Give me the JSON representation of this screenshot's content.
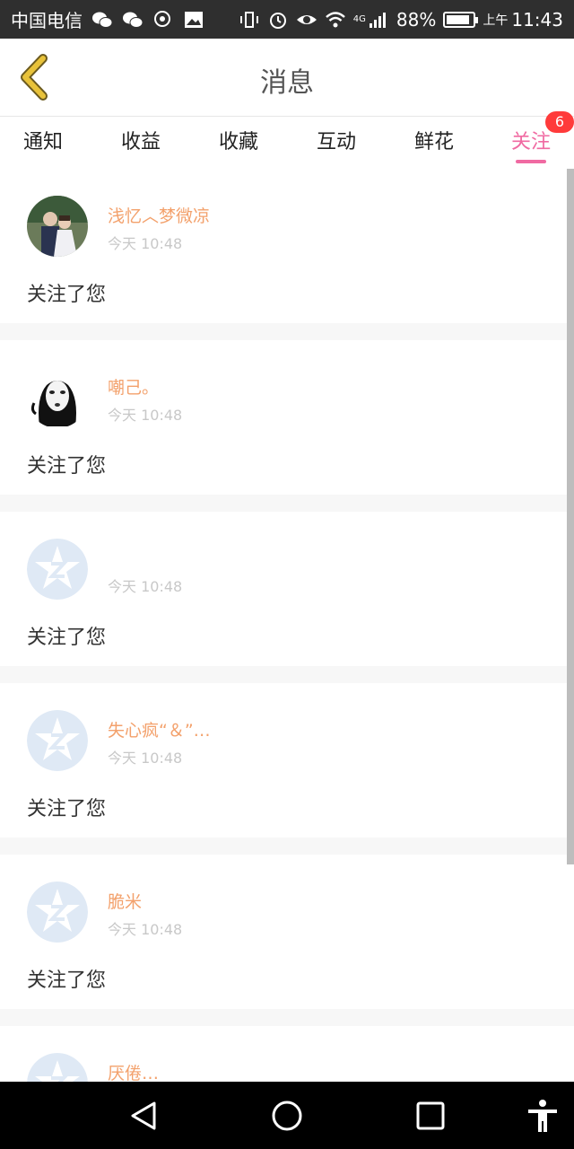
{
  "status_bar": {
    "carrier": "中国电信",
    "network": "4G",
    "battery": "88%",
    "battery_level": 0.88,
    "ampm": "上午",
    "time": "11:43"
  },
  "header": {
    "title": "消息",
    "back_icon": "chevron-left-icon"
  },
  "tabs": [
    {
      "label": "通知",
      "active": false
    },
    {
      "label": "收益",
      "active": false
    },
    {
      "label": "收藏",
      "active": false
    },
    {
      "label": "互动",
      "active": false
    },
    {
      "label": "鲜花",
      "active": false
    },
    {
      "label": "关注",
      "active": true,
      "badge": "6"
    }
  ],
  "items": [
    {
      "name": "浅忆︿梦微凉",
      "time": "今天 10:48",
      "action": "关注了您",
      "avatar": "photo-couple"
    },
    {
      "name": "嘲己。",
      "time": "今天 10:48",
      "action": "关注了您",
      "avatar": "photo-mask"
    },
    {
      "name": "",
      "time": "今天 10:48",
      "action": "关注了您",
      "avatar": "default-star"
    },
    {
      "name": "失心疯“＆”…",
      "time": "今天 10:48",
      "action": "关注了您",
      "avatar": "default-star"
    },
    {
      "name": "脆米",
      "time": "今天 10:48",
      "action": "关注了您",
      "avatar": "default-star"
    },
    {
      "name": "厌倦…",
      "time": "",
      "action": "",
      "avatar": "default-star"
    }
  ],
  "colors": {
    "accent": "#f06aa2",
    "name": "#f3a16c",
    "badge": "#ff3b3b",
    "back": "#e8c23a"
  }
}
